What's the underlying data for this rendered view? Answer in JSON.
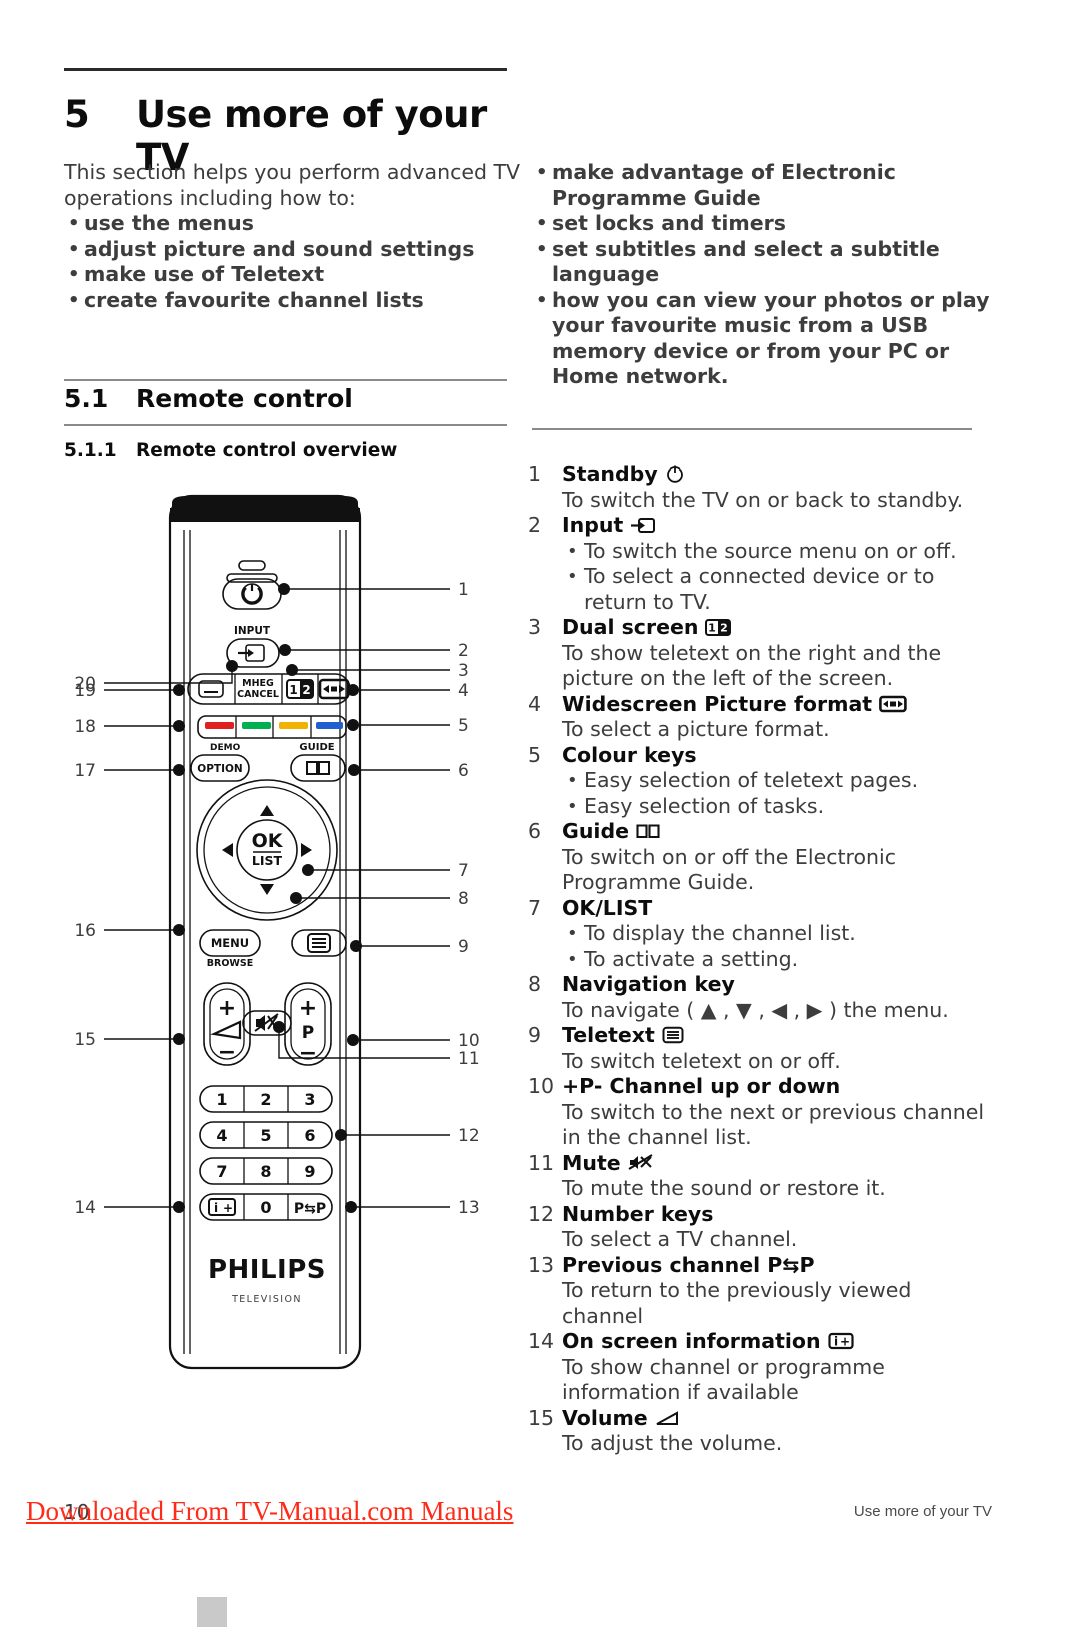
{
  "document": {
    "chapter_number": "5",
    "chapter_title": "Use more of your TV",
    "intro_left_paragraph": "This section helps you perform advanced TV operations including how to:",
    "intro_left_bullets": [
      "use the menus",
      "adjust picture and sound settings",
      "make use of Teletext",
      "create favourite channel lists"
    ],
    "intro_right_bullets": [
      "make advantage of Electronic Programme Guide",
      "set locks and timers",
      "set subtitles and select a subtitle language",
      "how you can view your photos or play your favourite music from a USB memory device or from your PC or Home network."
    ],
    "section": {
      "number": "5.1",
      "title": "Remote control"
    },
    "subsection": {
      "number": "5.1.1",
      "title": "Remote control overview"
    }
  },
  "key_list": [
    {
      "n": "1",
      "title": "Standby",
      "icon": "power-icon",
      "lines": [
        "To switch the TV on or back to standby."
      ],
      "bullets": []
    },
    {
      "n": "2",
      "title": "Input",
      "icon": "input-source-icon",
      "lines": [],
      "bullets": [
        "To switch the source menu on or off.",
        "To select a connected device or to return to TV."
      ]
    },
    {
      "n": "3",
      "title": "Dual screen",
      "icon": "dual-screen-icon",
      "lines": [
        "To show teletext on the right and the picture on the left of the screen."
      ],
      "bullets": []
    },
    {
      "n": "4",
      "title": "Widescreen Picture format",
      "icon": "widescreen-format-icon",
      "lines": [
        "To select a picture format."
      ],
      "bullets": []
    },
    {
      "n": "5",
      "title": "Colour keys",
      "icon": "",
      "lines": [],
      "bullets": [
        "Easy selection of teletext pages.",
        "Easy selection of tasks."
      ]
    },
    {
      "n": "6",
      "title": "Guide",
      "icon": "guide-book-icon",
      "lines": [
        "To switch on or off the Electronic Programme Guide."
      ],
      "bullets": []
    },
    {
      "n": "7",
      "title": "OK/LIST",
      "icon": "",
      "lines": [],
      "bullets": [
        "To display the channel list.",
        "To activate a setting."
      ]
    },
    {
      "n": "8",
      "title": "Navigation key",
      "icon": "",
      "lines": [
        "To navigate ( ▲ , ▼ , ◀ , ▶ ) the menu."
      ],
      "bullets": []
    },
    {
      "n": "9",
      "title": "Teletext",
      "icon": "teletext-icon",
      "lines": [
        "To switch teletext on or off."
      ],
      "bullets": []
    },
    {
      "n": "10",
      "title": "+P-  Channel up or down",
      "icon": "",
      "lines": [
        "To switch to the next or previous channel in the channel list."
      ],
      "bullets": []
    },
    {
      "n": "11",
      "title": "Mute",
      "icon": "mute-icon",
      "lines": [
        "To mute the sound or restore it."
      ],
      "bullets": []
    },
    {
      "n": "12",
      "title": "Number keys",
      "icon": "",
      "lines": [
        "To select a TV channel."
      ],
      "bullets": []
    },
    {
      "n": "13",
      "title": "Previous channel P⇆P",
      "icon": "",
      "lines": [
        "To return to the previously viewed channel"
      ],
      "bullets": []
    },
    {
      "n": "14",
      "title": "On screen information",
      "icon": "info-plus-icon",
      "lines": [
        "To show channel or programme information if available"
      ],
      "bullets": []
    },
    {
      "n": "15",
      "title": "Volume",
      "icon": "volume-wedge-icon",
      "lines": [
        "To adjust the volume."
      ],
      "bullets": []
    }
  ],
  "remote": {
    "labels": {
      "input": "INPUT",
      "mheg_cancel_line1": "MHEG",
      "mheg_cancel_line2": "CANCEL",
      "demo": "DEMO",
      "option": "OPTION",
      "guide": "GUIDE",
      "ok": "OK",
      "list": "LIST",
      "menu": "MENU",
      "browse": "BROWSE",
      "volume_plus": "+",
      "volume_minus": "−",
      "program_plus": "+",
      "program_letter": "P",
      "program_minus": "−",
      "brand": "PHILIPS",
      "brand_sub": "TELEVISION"
    },
    "number_keys": [
      "1",
      "2",
      "3",
      "4",
      "5",
      "6",
      "7",
      "8",
      "9"
    ],
    "bottom_keys": [
      "i+",
      "0",
      "P⇆P"
    ],
    "colour_keys": [
      "#e02020",
      "#00b050",
      "#f2b200",
      "#1f5fd0"
    ],
    "callouts_right": [
      "1",
      "2",
      "3",
      "4",
      "5",
      "6",
      "7",
      "8",
      "9",
      "10",
      "11",
      "12",
      "13"
    ],
    "callouts_left": [
      "20",
      "19",
      "18",
      "17",
      "16",
      "15",
      "14"
    ]
  },
  "footer": {
    "page_number": "10",
    "right_text": "Use more of your TV",
    "watermark": "Downloaded From TV-Manual.com Manuals",
    "watermark_color": "#ff2a17"
  }
}
